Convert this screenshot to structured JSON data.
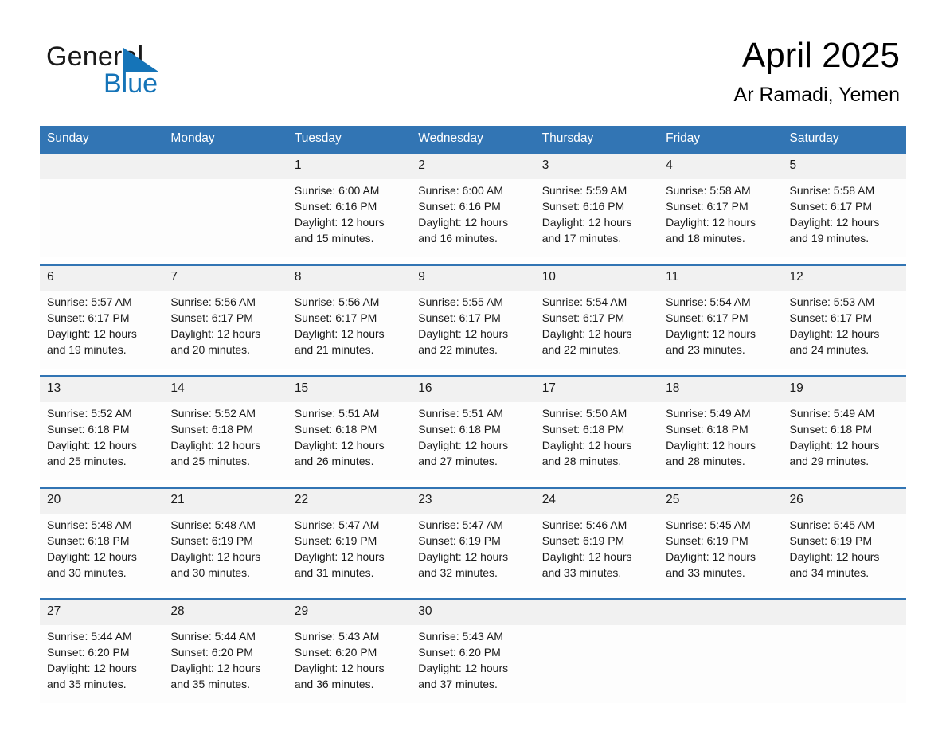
{
  "brand": {
    "name_part1": "General",
    "name_part2": "Blue",
    "accent_color": "#1574b8",
    "triangle_icon": "triangle-icon"
  },
  "header": {
    "title": "April 2025",
    "location": "Ar Ramadi, Yemen"
  },
  "calendar": {
    "header_color": "#3275b4",
    "date_band_color": "#f1f1f1",
    "weekday_headers": [
      "Sunday",
      "Monday",
      "Tuesday",
      "Wednesday",
      "Thursday",
      "Friday",
      "Saturday"
    ],
    "weeks": [
      {
        "days": [
          {
            "date": "",
            "sunrise": "",
            "sunset": "",
            "daylight": ""
          },
          {
            "date": "",
            "sunrise": "",
            "sunset": "",
            "daylight": ""
          },
          {
            "date": "1",
            "sunrise": "Sunrise: 6:00 AM",
            "sunset": "Sunset: 6:16 PM",
            "daylight": "Daylight: 12 hours and 15 minutes."
          },
          {
            "date": "2",
            "sunrise": "Sunrise: 6:00 AM",
            "sunset": "Sunset: 6:16 PM",
            "daylight": "Daylight: 12 hours and 16 minutes."
          },
          {
            "date": "3",
            "sunrise": "Sunrise: 5:59 AM",
            "sunset": "Sunset: 6:16 PM",
            "daylight": "Daylight: 12 hours and 17 minutes."
          },
          {
            "date": "4",
            "sunrise": "Sunrise: 5:58 AM",
            "sunset": "Sunset: 6:17 PM",
            "daylight": "Daylight: 12 hours and 18 minutes."
          },
          {
            "date": "5",
            "sunrise": "Sunrise: 5:58 AM",
            "sunset": "Sunset: 6:17 PM",
            "daylight": "Daylight: 12 hours and 19 minutes."
          }
        ]
      },
      {
        "days": [
          {
            "date": "6",
            "sunrise": "Sunrise: 5:57 AM",
            "sunset": "Sunset: 6:17 PM",
            "daylight": "Daylight: 12 hours and 19 minutes."
          },
          {
            "date": "7",
            "sunrise": "Sunrise: 5:56 AM",
            "sunset": "Sunset: 6:17 PM",
            "daylight": "Daylight: 12 hours and 20 minutes."
          },
          {
            "date": "8",
            "sunrise": "Sunrise: 5:56 AM",
            "sunset": "Sunset: 6:17 PM",
            "daylight": "Daylight: 12 hours and 21 minutes."
          },
          {
            "date": "9",
            "sunrise": "Sunrise: 5:55 AM",
            "sunset": "Sunset: 6:17 PM",
            "daylight": "Daylight: 12 hours and 22 minutes."
          },
          {
            "date": "10",
            "sunrise": "Sunrise: 5:54 AM",
            "sunset": "Sunset: 6:17 PM",
            "daylight": "Daylight: 12 hours and 22 minutes."
          },
          {
            "date": "11",
            "sunrise": "Sunrise: 5:54 AM",
            "sunset": "Sunset: 6:17 PM",
            "daylight": "Daylight: 12 hours and 23 minutes."
          },
          {
            "date": "12",
            "sunrise": "Sunrise: 5:53 AM",
            "sunset": "Sunset: 6:17 PM",
            "daylight": "Daylight: 12 hours and 24 minutes."
          }
        ]
      },
      {
        "days": [
          {
            "date": "13",
            "sunrise": "Sunrise: 5:52 AM",
            "sunset": "Sunset: 6:18 PM",
            "daylight": "Daylight: 12 hours and 25 minutes."
          },
          {
            "date": "14",
            "sunrise": "Sunrise: 5:52 AM",
            "sunset": "Sunset: 6:18 PM",
            "daylight": "Daylight: 12 hours and 25 minutes."
          },
          {
            "date": "15",
            "sunrise": "Sunrise: 5:51 AM",
            "sunset": "Sunset: 6:18 PM",
            "daylight": "Daylight: 12 hours and 26 minutes."
          },
          {
            "date": "16",
            "sunrise": "Sunrise: 5:51 AM",
            "sunset": "Sunset: 6:18 PM",
            "daylight": "Daylight: 12 hours and 27 minutes."
          },
          {
            "date": "17",
            "sunrise": "Sunrise: 5:50 AM",
            "sunset": "Sunset: 6:18 PM",
            "daylight": "Daylight: 12 hours and 28 minutes."
          },
          {
            "date": "18",
            "sunrise": "Sunrise: 5:49 AM",
            "sunset": "Sunset: 6:18 PM",
            "daylight": "Daylight: 12 hours and 28 minutes."
          },
          {
            "date": "19",
            "sunrise": "Sunrise: 5:49 AM",
            "sunset": "Sunset: 6:18 PM",
            "daylight": "Daylight: 12 hours and 29 minutes."
          }
        ]
      },
      {
        "days": [
          {
            "date": "20",
            "sunrise": "Sunrise: 5:48 AM",
            "sunset": "Sunset: 6:18 PM",
            "daylight": "Daylight: 12 hours and 30 minutes."
          },
          {
            "date": "21",
            "sunrise": "Sunrise: 5:48 AM",
            "sunset": "Sunset: 6:19 PM",
            "daylight": "Daylight: 12 hours and 30 minutes."
          },
          {
            "date": "22",
            "sunrise": "Sunrise: 5:47 AM",
            "sunset": "Sunset: 6:19 PM",
            "daylight": "Daylight: 12 hours and 31 minutes."
          },
          {
            "date": "23",
            "sunrise": "Sunrise: 5:47 AM",
            "sunset": "Sunset: 6:19 PM",
            "daylight": "Daylight: 12 hours and 32 minutes."
          },
          {
            "date": "24",
            "sunrise": "Sunrise: 5:46 AM",
            "sunset": "Sunset: 6:19 PM",
            "daylight": "Daylight: 12 hours and 33 minutes."
          },
          {
            "date": "25",
            "sunrise": "Sunrise: 5:45 AM",
            "sunset": "Sunset: 6:19 PM",
            "daylight": "Daylight: 12 hours and 33 minutes."
          },
          {
            "date": "26",
            "sunrise": "Sunrise: 5:45 AM",
            "sunset": "Sunset: 6:19 PM",
            "daylight": "Daylight: 12 hours and 34 minutes."
          }
        ]
      },
      {
        "days": [
          {
            "date": "27",
            "sunrise": "Sunrise: 5:44 AM",
            "sunset": "Sunset: 6:20 PM",
            "daylight": "Daylight: 12 hours and 35 minutes."
          },
          {
            "date": "28",
            "sunrise": "Sunrise: 5:44 AM",
            "sunset": "Sunset: 6:20 PM",
            "daylight": "Daylight: 12 hours and 35 minutes."
          },
          {
            "date": "29",
            "sunrise": "Sunrise: 5:43 AM",
            "sunset": "Sunset: 6:20 PM",
            "daylight": "Daylight: 12 hours and 36 minutes."
          },
          {
            "date": "30",
            "sunrise": "Sunrise: 5:43 AM",
            "sunset": "Sunset: 6:20 PM",
            "daylight": "Daylight: 12 hours and 37 minutes."
          },
          {
            "date": "",
            "sunrise": "",
            "sunset": "",
            "daylight": ""
          },
          {
            "date": "",
            "sunrise": "",
            "sunset": "",
            "daylight": ""
          },
          {
            "date": "",
            "sunrise": "",
            "sunset": "",
            "daylight": ""
          }
        ]
      }
    ]
  }
}
